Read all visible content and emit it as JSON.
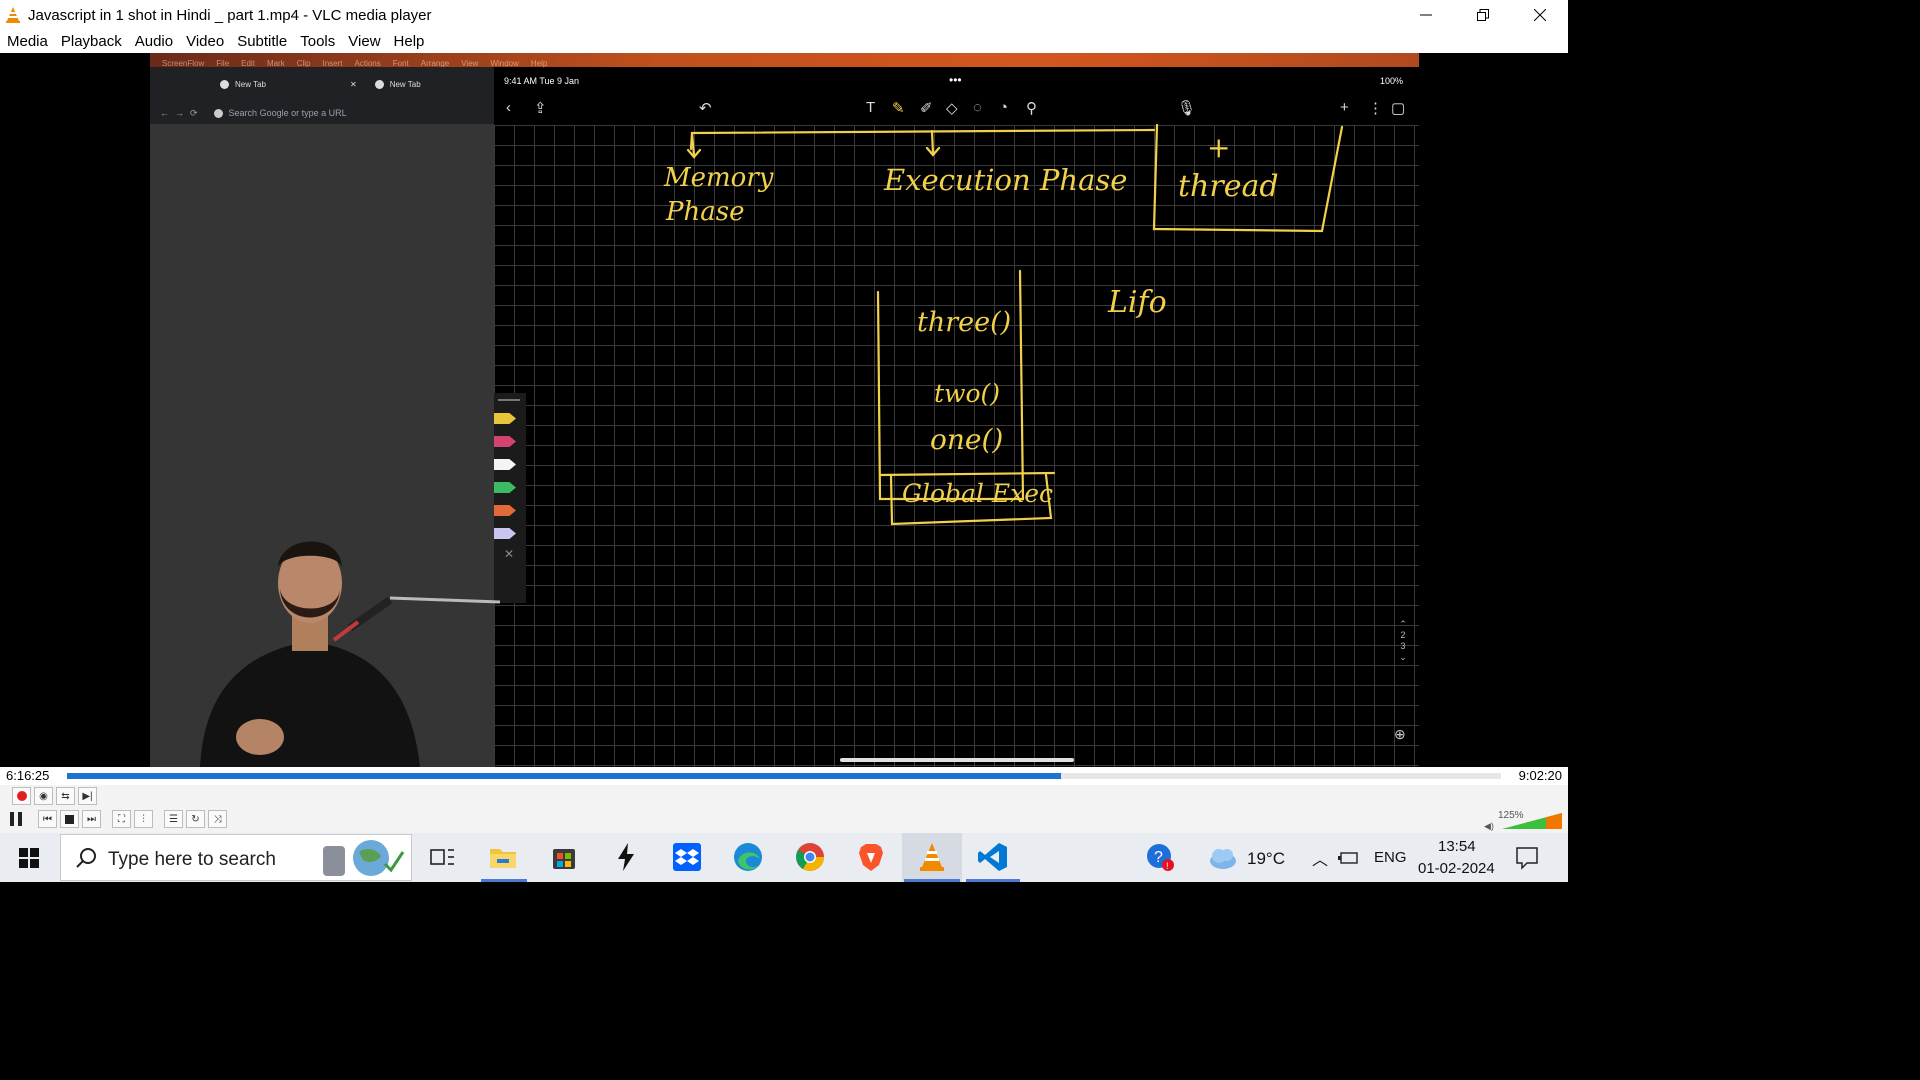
{
  "window": {
    "title": "Javascript in 1 shot in Hindi _ part 1.mp4 - VLC media player",
    "icon": "vlc-cone-icon"
  },
  "menu": [
    "Media",
    "Playback",
    "Audio",
    "Video",
    "Subtitle",
    "Tools",
    "View",
    "Help"
  ],
  "video_frame": {
    "mac_menubar": [
      "ScreenFlow",
      "File",
      "Edit",
      "Mark",
      "Clip",
      "Insert",
      "Actions",
      "Font",
      "Arrange",
      "View",
      "Window",
      "Help"
    ],
    "browser": {
      "tabs": [
        "New Tab",
        "New Tab"
      ],
      "url_placeholder": "Search Google or type a URL"
    },
    "ipad": {
      "time": "9:41 AM  Tue 9 Jan",
      "battery": "100%",
      "notes": {
        "memory_phase": "Memory",
        "memory_phase_2": "Phase",
        "execution_phase": "Execution Phase",
        "thread": "thread",
        "plus": "+",
        "lifo": "Lifo",
        "stack": [
          "three()",
          "two()",
          "one()",
          "Global Exec"
        ]
      },
      "page_indicator": [
        "2",
        "3"
      ]
    }
  },
  "player": {
    "current_time": "6:16:25",
    "total_time": "9:02:20",
    "progress": 0.6935,
    "volume": "125%"
  },
  "taskbar": {
    "search_placeholder": "Type here to search",
    "weather": "19°C",
    "language": "ENG",
    "time": "13:54",
    "date": "01-02-2024"
  },
  "colors": {
    "seek_fill": "#1d73cf",
    "ink": "#f2d14a",
    "vlc_orange": "#f08a00"
  }
}
